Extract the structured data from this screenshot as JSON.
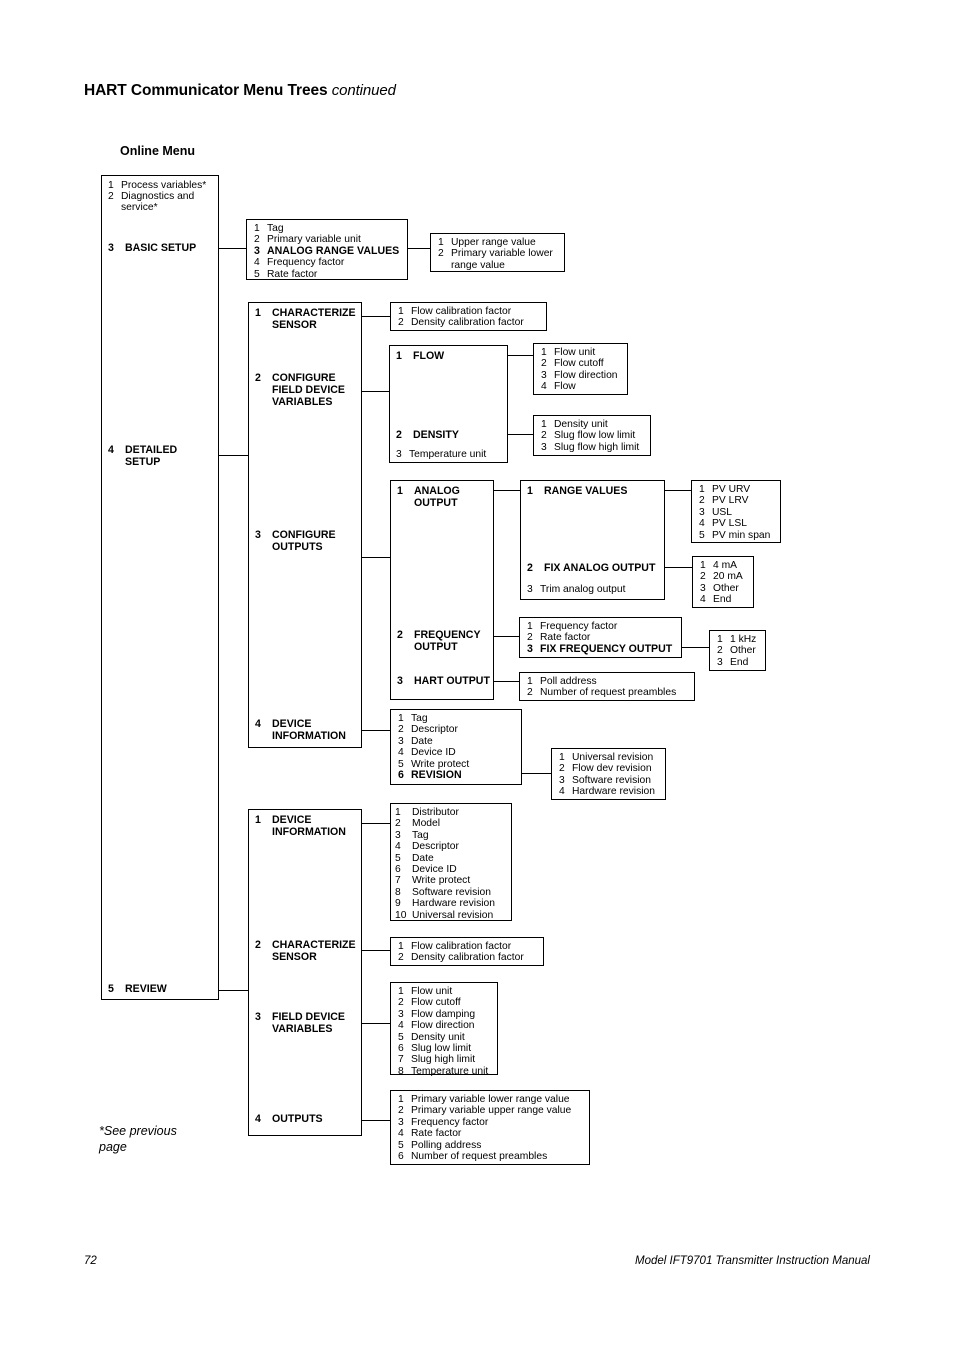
{
  "header": {
    "title": "HART Communicator Menu Trees",
    "continued": "continued"
  },
  "section_title": "Online Menu",
  "footnote": "*See previous\npage",
  "footer": {
    "page_number": "72",
    "manual_title": "Model IFT9701 Transmitter Instruction Manual"
  },
  "online_menu": {
    "items": [
      {
        "num": "1",
        "label": "Process variables*"
      },
      {
        "num": "2",
        "label": "Diagnostics and\nservice*"
      },
      {
        "num": "3",
        "label": "BASIC SETUP"
      },
      {
        "num": "4",
        "label": "DETAILED\nSETUP"
      },
      {
        "num": "5",
        "label": "REVIEW"
      }
    ]
  },
  "basic_setup": {
    "items": [
      {
        "num": "1",
        "label": "Tag"
      },
      {
        "num": "2",
        "label": "Primary variable unit"
      },
      {
        "num": "3",
        "label": "ANALOG RANGE VALUES"
      },
      {
        "num": "4",
        "label": "Frequency factor"
      },
      {
        "num": "5",
        "label": "Rate factor"
      }
    ]
  },
  "analog_range_values": {
    "items": [
      {
        "num": "1",
        "label": "Upper range value"
      },
      {
        "num": "2",
        "label": "Primary variable lower\nrange value"
      }
    ]
  },
  "detailed_setup": {
    "items": [
      {
        "num": "1",
        "label": "CHARACTERIZE\nSENSOR"
      },
      {
        "num": "2",
        "label": "CONFIGURE\nFIELD DEVICE\nVARIABLES"
      },
      {
        "num": "3",
        "label": "CONFIGURE\nOUTPUTS"
      },
      {
        "num": "4",
        "label": "DEVICE\nINFORMATION"
      }
    ]
  },
  "ds_characterize_sensor": {
    "items": [
      {
        "num": "1",
        "label": "Flow calibration factor"
      },
      {
        "num": "2",
        "label": "Density calibration factor"
      }
    ]
  },
  "ds_field_device_variables": {
    "items": [
      {
        "num": "1",
        "label": "FLOW"
      },
      {
        "num": "2",
        "label": "DENSITY"
      },
      {
        "num": "3",
        "label": "Temperature unit"
      }
    ]
  },
  "ds_flow": {
    "items": [
      {
        "num": "1",
        "label": "Flow unit"
      },
      {
        "num": "2",
        "label": "Flow cutoff"
      },
      {
        "num": "3",
        "label": "Flow direction"
      },
      {
        "num": "4",
        "label": "Flow"
      }
    ]
  },
  "ds_density": {
    "items": [
      {
        "num": "1",
        "label": "Density unit"
      },
      {
        "num": "2",
        "label": "Slug flow low limit"
      },
      {
        "num": "3",
        "label": "Slug flow high limit"
      }
    ]
  },
  "ds_configure_outputs": {
    "items": [
      {
        "num": "1",
        "label": "ANALOG\nOUTPUT"
      },
      {
        "num": "2",
        "label": "FREQUENCY\nOUTPUT"
      },
      {
        "num": "3",
        "label": "HART OUTPUT"
      }
    ]
  },
  "ds_analog_output": {
    "items": [
      {
        "num": "1",
        "label": "RANGE VALUES"
      },
      {
        "num": "2",
        "label": "FIX ANALOG OUTPUT"
      },
      {
        "num": "3",
        "label": "Trim analog output"
      }
    ]
  },
  "ds_range_values": {
    "items": [
      {
        "num": "1",
        "label": "PV URV"
      },
      {
        "num": "2",
        "label": "PV LRV"
      },
      {
        "num": "3",
        "label": "USL"
      },
      {
        "num": "4",
        "label": "PV LSL"
      },
      {
        "num": "5",
        "label": "PV min span"
      }
    ]
  },
  "ds_fix_analog_output": {
    "items": [
      {
        "num": "1",
        "label": "4 mA"
      },
      {
        "num": "2",
        "label": "20 mA"
      },
      {
        "num": "3",
        "label": "Other"
      },
      {
        "num": "4",
        "label": "End"
      }
    ]
  },
  "ds_frequency_output": {
    "items": [
      {
        "num": "1",
        "label": "Frequency factor"
      },
      {
        "num": "2",
        "label": "Rate factor"
      },
      {
        "num": "3",
        "label": "FIX FREQUENCY OUTPUT"
      }
    ]
  },
  "ds_fix_frequency_output": {
    "items": [
      {
        "num": "1",
        "label": "1 kHz"
      },
      {
        "num": "2",
        "label": "Other"
      },
      {
        "num": "3",
        "label": "End"
      }
    ]
  },
  "ds_hart_output": {
    "items": [
      {
        "num": "1",
        "label": "Poll address"
      },
      {
        "num": "2",
        "label": "Number of request preambles"
      }
    ]
  },
  "ds_device_information": {
    "items": [
      {
        "num": "1",
        "label": "Tag"
      },
      {
        "num": "2",
        "label": "Descriptor"
      },
      {
        "num": "3",
        "label": "Date"
      },
      {
        "num": "4",
        "label": "Device ID"
      },
      {
        "num": "5",
        "label": "Write protect"
      },
      {
        "num": "6",
        "label": "REVISION"
      }
    ]
  },
  "ds_revision": {
    "items": [
      {
        "num": "1",
        "label": "Universal revision"
      },
      {
        "num": "2",
        "label": "Flow dev revision"
      },
      {
        "num": "3",
        "label": "Software revision"
      },
      {
        "num": "4",
        "label": "Hardware revision"
      }
    ]
  },
  "review": {
    "items": [
      {
        "num": "1",
        "label": "DEVICE\nINFORMATION"
      },
      {
        "num": "2",
        "label": "CHARACTERIZE\nSENSOR"
      },
      {
        "num": "3",
        "label": "FIELD DEVICE\nVARIABLES"
      },
      {
        "num": "4",
        "label": "OUTPUTS"
      }
    ]
  },
  "rv_device_information": {
    "items": [
      {
        "num": "1",
        "label": "Distributor"
      },
      {
        "num": "2",
        "label": "Model"
      },
      {
        "num": "3",
        "label": "Tag"
      },
      {
        "num": "4",
        "label": "Descriptor"
      },
      {
        "num": "5",
        "label": "Date"
      },
      {
        "num": "6",
        "label": "Device ID"
      },
      {
        "num": "7",
        "label": "Write protect"
      },
      {
        "num": "8",
        "label": "Software revision"
      },
      {
        "num": "9",
        "label": "Hardware revision"
      },
      {
        "num": "10",
        "label": "Universal revision"
      }
    ]
  },
  "rv_characterize_sensor": {
    "items": [
      {
        "num": "1",
        "label": "Flow calibration factor"
      },
      {
        "num": "2",
        "label": "Density calibration factor"
      }
    ]
  },
  "rv_field_device_variables": {
    "items": [
      {
        "num": "1",
        "label": "Flow unit"
      },
      {
        "num": "2",
        "label": "Flow cutoff"
      },
      {
        "num": "3",
        "label": "Flow damping"
      },
      {
        "num": "4",
        "label": "Flow direction"
      },
      {
        "num": "5",
        "label": "Density unit"
      },
      {
        "num": "6",
        "label": "Slug low limit"
      },
      {
        "num": "7",
        "label": "Slug high limit"
      },
      {
        "num": "8",
        "label": "Temperature unit"
      }
    ]
  },
  "rv_outputs": {
    "items": [
      {
        "num": "1",
        "label": "Primary variable lower range value"
      },
      {
        "num": "2",
        "label": "Primary variable upper range value"
      },
      {
        "num": "3",
        "label": "Frequency factor"
      },
      {
        "num": "4",
        "label": "Rate factor"
      },
      {
        "num": "5",
        "label": "Polling address"
      },
      {
        "num": "6",
        "label": "Number of request preambles"
      }
    ]
  }
}
